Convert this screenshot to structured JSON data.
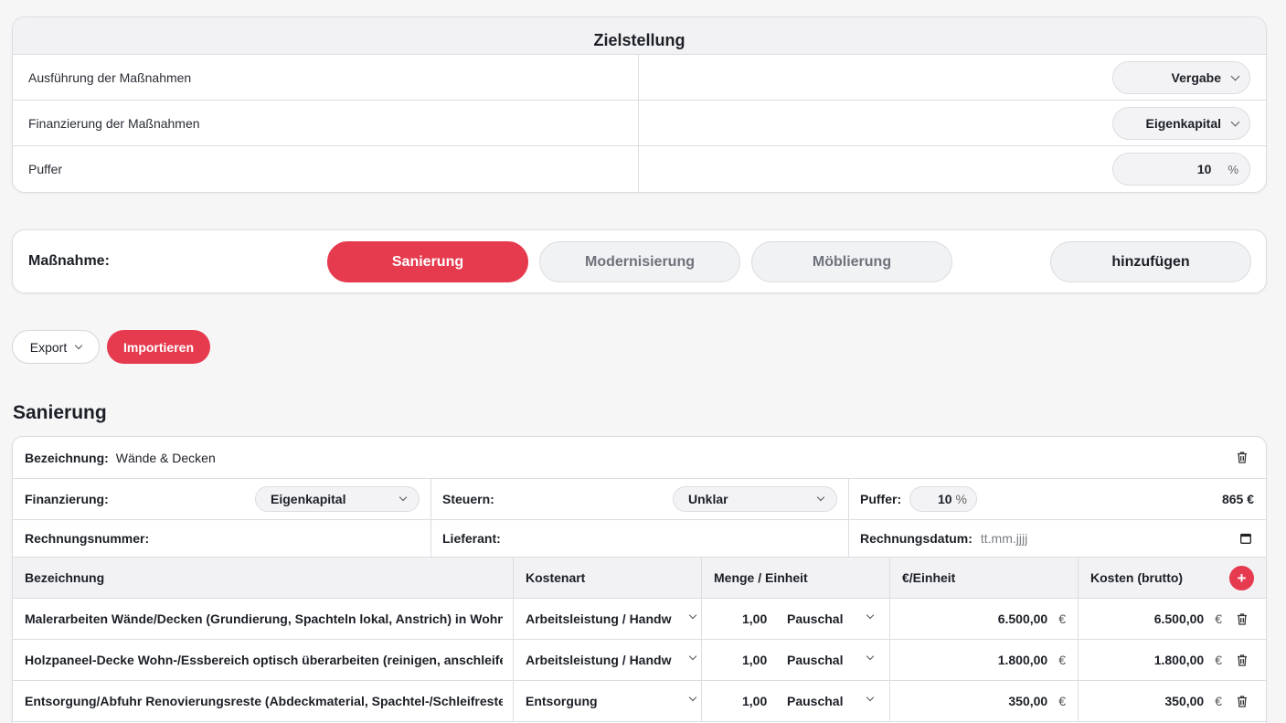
{
  "ziel": {
    "title": "Zielstellung",
    "rows": [
      {
        "label": "Ausführung der Maßnahmen",
        "value": "Vergabe"
      },
      {
        "label": "Finanzierung der Maßnahmen",
        "value": "Eigenkapital"
      },
      {
        "label": "Puffer",
        "value": "10",
        "unit": "%"
      }
    ]
  },
  "massnahme": {
    "label": "Maßnahme:",
    "tabs": [
      "Sanierung",
      "Modernisierung",
      "Möblierung"
    ],
    "add": "hinzufügen"
  },
  "actions": {
    "export": "Export",
    "import": "Importieren"
  },
  "section": {
    "title": "Sanierung"
  },
  "block": {
    "bez_label": "Bezeichnung:",
    "bez_value": "Wände & Decken",
    "fin_label": "Finanzierung:",
    "fin_value": "Eigenkapital",
    "steuern_label": "Steuern:",
    "steuern_value": "Unklar",
    "puffer_label": "Puffer:",
    "puffer_value": "10",
    "puffer_unit": "%",
    "total": "865 €",
    "rnr_label": "Rechnungsnummer:",
    "lief_label": "Lieferant:",
    "rdat_label": "Rechnungsdatum:",
    "rdat_placeholder": "tt.mm.jjjj"
  },
  "table": {
    "headers": [
      "Bezeichnung",
      "Kostenart",
      "Menge / Einheit",
      "€/Einheit",
      "Kosten (brutto)"
    ],
    "add": "+",
    "currency": "€",
    "rows": [
      {
        "bez": "Malerarbeiten Wände/Decken (Grundierung, Spachteln lokal, Anstrich) in Wohnung",
        "art": "Arbeitsleistung / Handwerker",
        "menge": "1,00",
        "einheit": "Pauschal",
        "preis": "6.500,00",
        "kosten": "6.500,00"
      },
      {
        "bez": "Holzpaneel-Decke Wohn-/Essbereich optisch überarbeiten (reinigen, anschleifen)",
        "art": "Arbeitsleistung / Handwerker",
        "menge": "1,00",
        "einheit": "Pauschal",
        "preis": "1.800,00",
        "kosten": "1.800,00"
      },
      {
        "bez": "Entsorgung/Abfuhr Renovierungsreste (Abdeckmaterial, Spachtel-/Schleifreste)",
        "art": "Entsorgung",
        "menge": "1,00",
        "einheit": "Pauschal",
        "preis": "350,00",
        "kosten": "350,00"
      }
    ]
  }
}
